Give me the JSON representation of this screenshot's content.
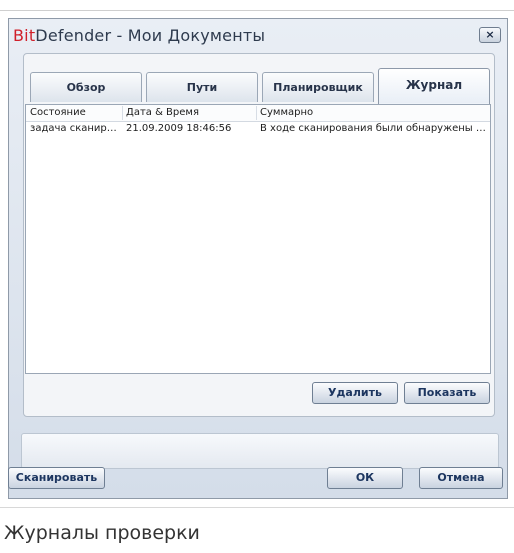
{
  "window": {
    "title_brand": "Bit",
    "title_rest": "Defender - Мои Документы",
    "close_label": "×"
  },
  "tabs": [
    {
      "label": "Обзор",
      "active": false
    },
    {
      "label": "Пути",
      "active": false
    },
    {
      "label": "Планировщик",
      "active": false
    },
    {
      "label": "Журнал",
      "active": true
    }
  ],
  "log_table": {
    "columns": [
      "Состояние",
      "Дата & Время",
      "Суммарно"
    ],
    "rows": [
      [
        "задача сканиро...",
        "21.09.2009 18:46:56",
        "В ходе сканирования были обнаружены у..."
      ]
    ]
  },
  "buttons": {
    "delete": "Удалить",
    "show": "Показать",
    "scan": "Сканировать",
    "ok": "ОК",
    "cancel": "Отмена"
  },
  "caption": "Журналы проверки"
}
